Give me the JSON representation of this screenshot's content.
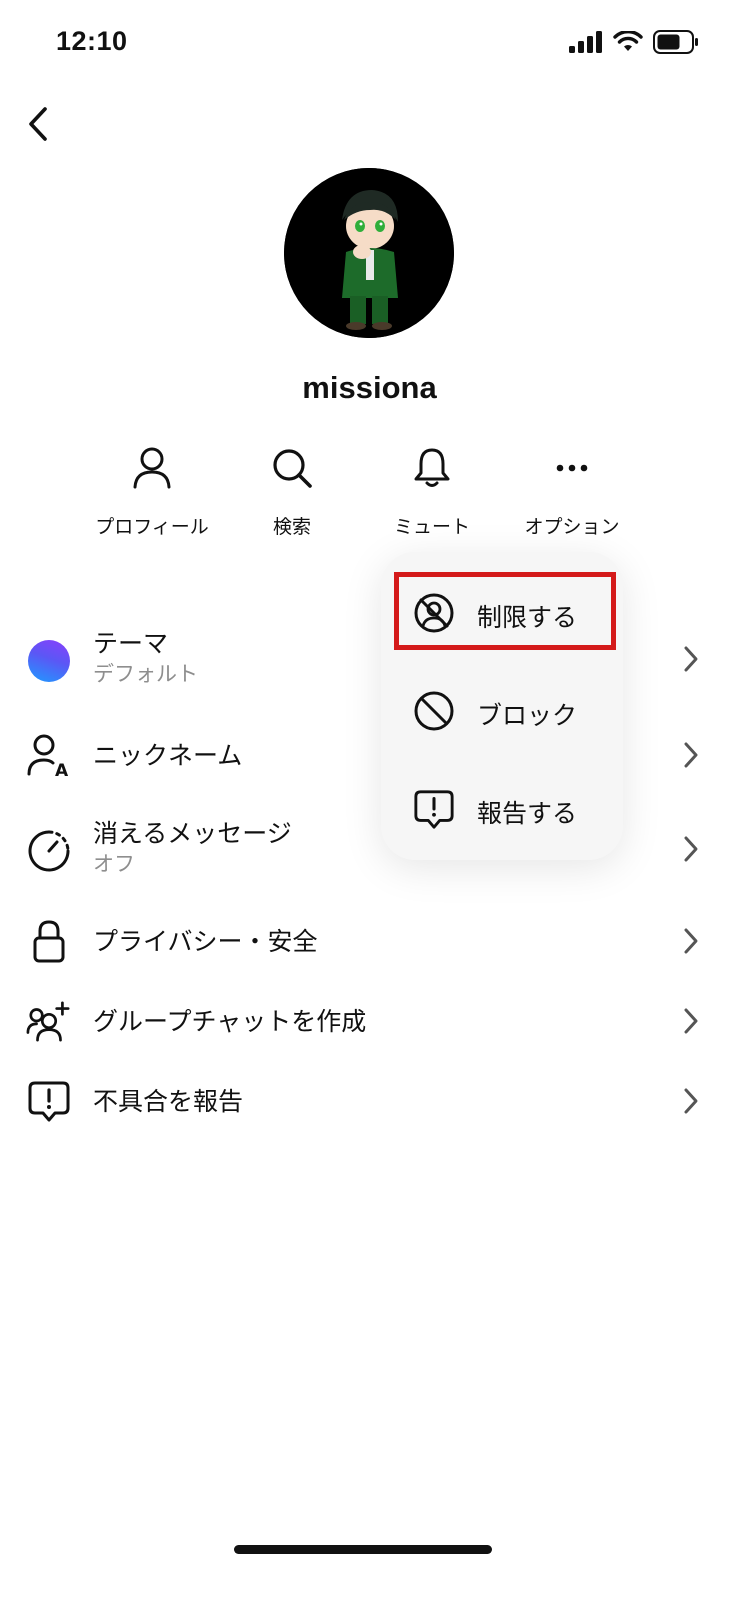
{
  "status_bar": {
    "time": "12:10"
  },
  "profile": {
    "username": "missiona"
  },
  "actions": [
    {
      "label": "プロフィール",
      "icon": "person-icon"
    },
    {
      "label": "検索",
      "icon": "search-icon"
    },
    {
      "label": "ミュート",
      "icon": "bell-icon"
    },
    {
      "label": "オプション",
      "icon": "more-icon"
    }
  ],
  "settings": [
    {
      "title": "テーマ",
      "subtitle": "デフォルト",
      "icon": "theme-gradient-dot"
    },
    {
      "title": "ニックネーム",
      "icon": "nickname-icon"
    },
    {
      "title": "消えるメッセージ",
      "subtitle": "オフ",
      "icon": "timer-icon"
    },
    {
      "title": "プライバシー・安全",
      "icon": "lock-icon"
    },
    {
      "title": "グループチャットを作成",
      "icon": "add-group-icon"
    },
    {
      "title": "不具合を報告",
      "icon": "report-bubble-icon"
    }
  ],
  "options_menu": {
    "items": [
      {
        "label": "制限する",
        "icon": "restrict-icon",
        "highlighted": true
      },
      {
        "label": "ブロック",
        "icon": "block-icon"
      },
      {
        "label": "報告する",
        "icon": "report-bubble-icon"
      }
    ]
  },
  "colors": {
    "highlight": "#d41a1a",
    "theme_gradient": [
      "#8a3ffc",
      "#1e9bff"
    ],
    "popup_background": "#f6f6f6",
    "subtitle_gray": "#8e8e8e"
  }
}
